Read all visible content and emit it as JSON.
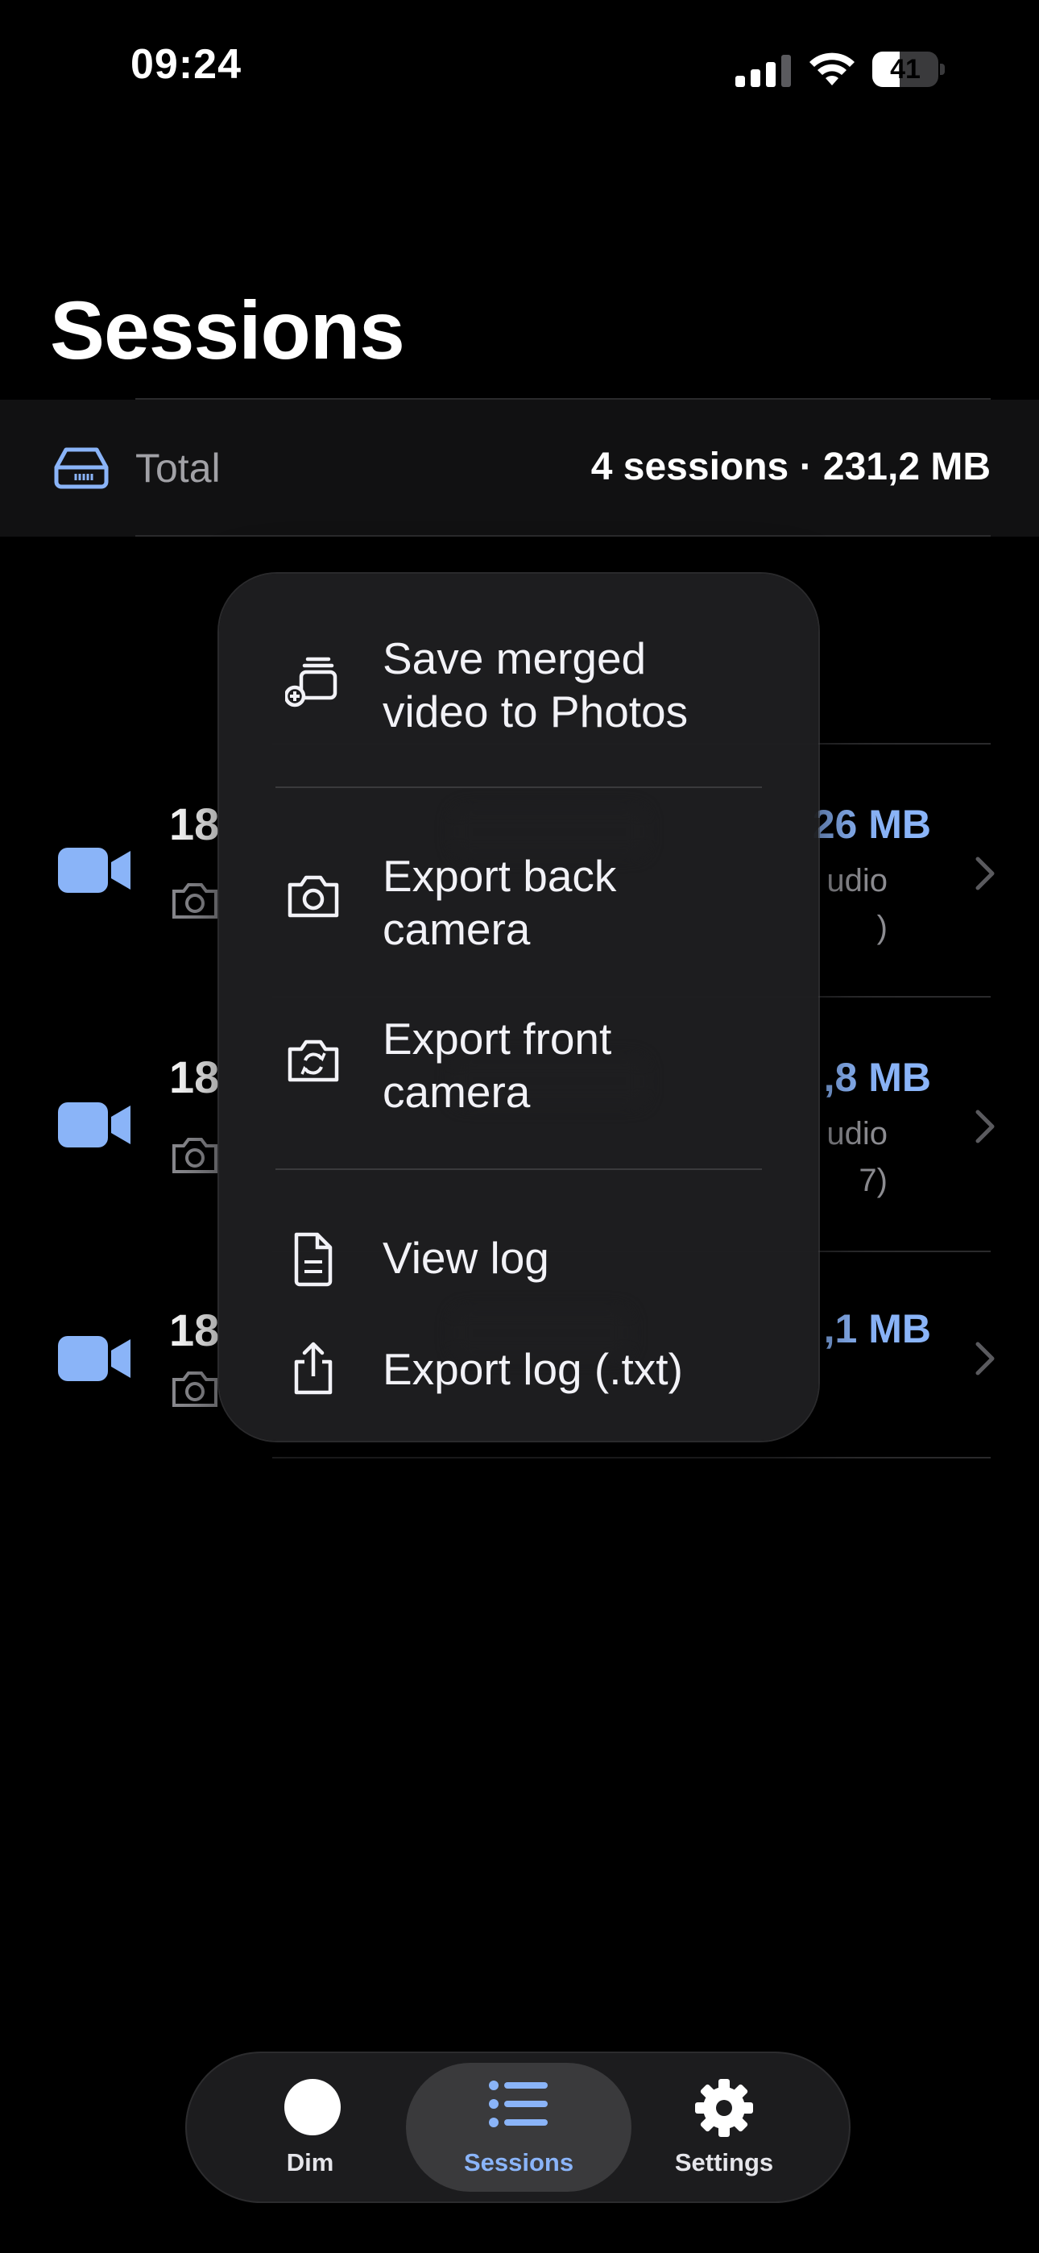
{
  "status_bar": {
    "time": "09:24",
    "battery_level": 41,
    "battery_label": "41"
  },
  "page": {
    "title": "Sessions"
  },
  "total": {
    "label": "Total",
    "value": "4 sessions · 231,2 MB"
  },
  "sessions": [
    {
      "time_partial": "18",
      "size_partial": "26 MB",
      "meta_line1": "udio",
      "meta_line2": ")"
    },
    {
      "time_partial": "18",
      "size_partial": ",8 MB",
      "meta_line1": "udio",
      "meta_line2": "7)"
    },
    {
      "time_partial": "18",
      "size_partial": ",1 MB"
    }
  ],
  "context_menu": {
    "items": [
      {
        "label_line1": "Save merged",
        "label_line2": "video to Photos",
        "icon": "save-merged-icon"
      },
      {
        "label_line1": "Export back",
        "label_line2": "camera",
        "icon": "camera-icon"
      },
      {
        "label_line1": "Export front",
        "label_line2": "camera",
        "icon": "camera-rotate-icon"
      },
      {
        "label": "View log",
        "icon": "document-icon"
      },
      {
        "label": "Export log (.txt)",
        "icon": "share-icon"
      }
    ]
  },
  "tab_bar": {
    "tabs": [
      {
        "label": "Dim",
        "icon": "circle-icon"
      },
      {
        "label": "Sessions",
        "icon": "list-icon",
        "active": true
      },
      {
        "label": "Settings",
        "icon": "gear-icon"
      }
    ]
  },
  "colors": {
    "accent": "#8ab4f8",
    "background": "#000000"
  }
}
